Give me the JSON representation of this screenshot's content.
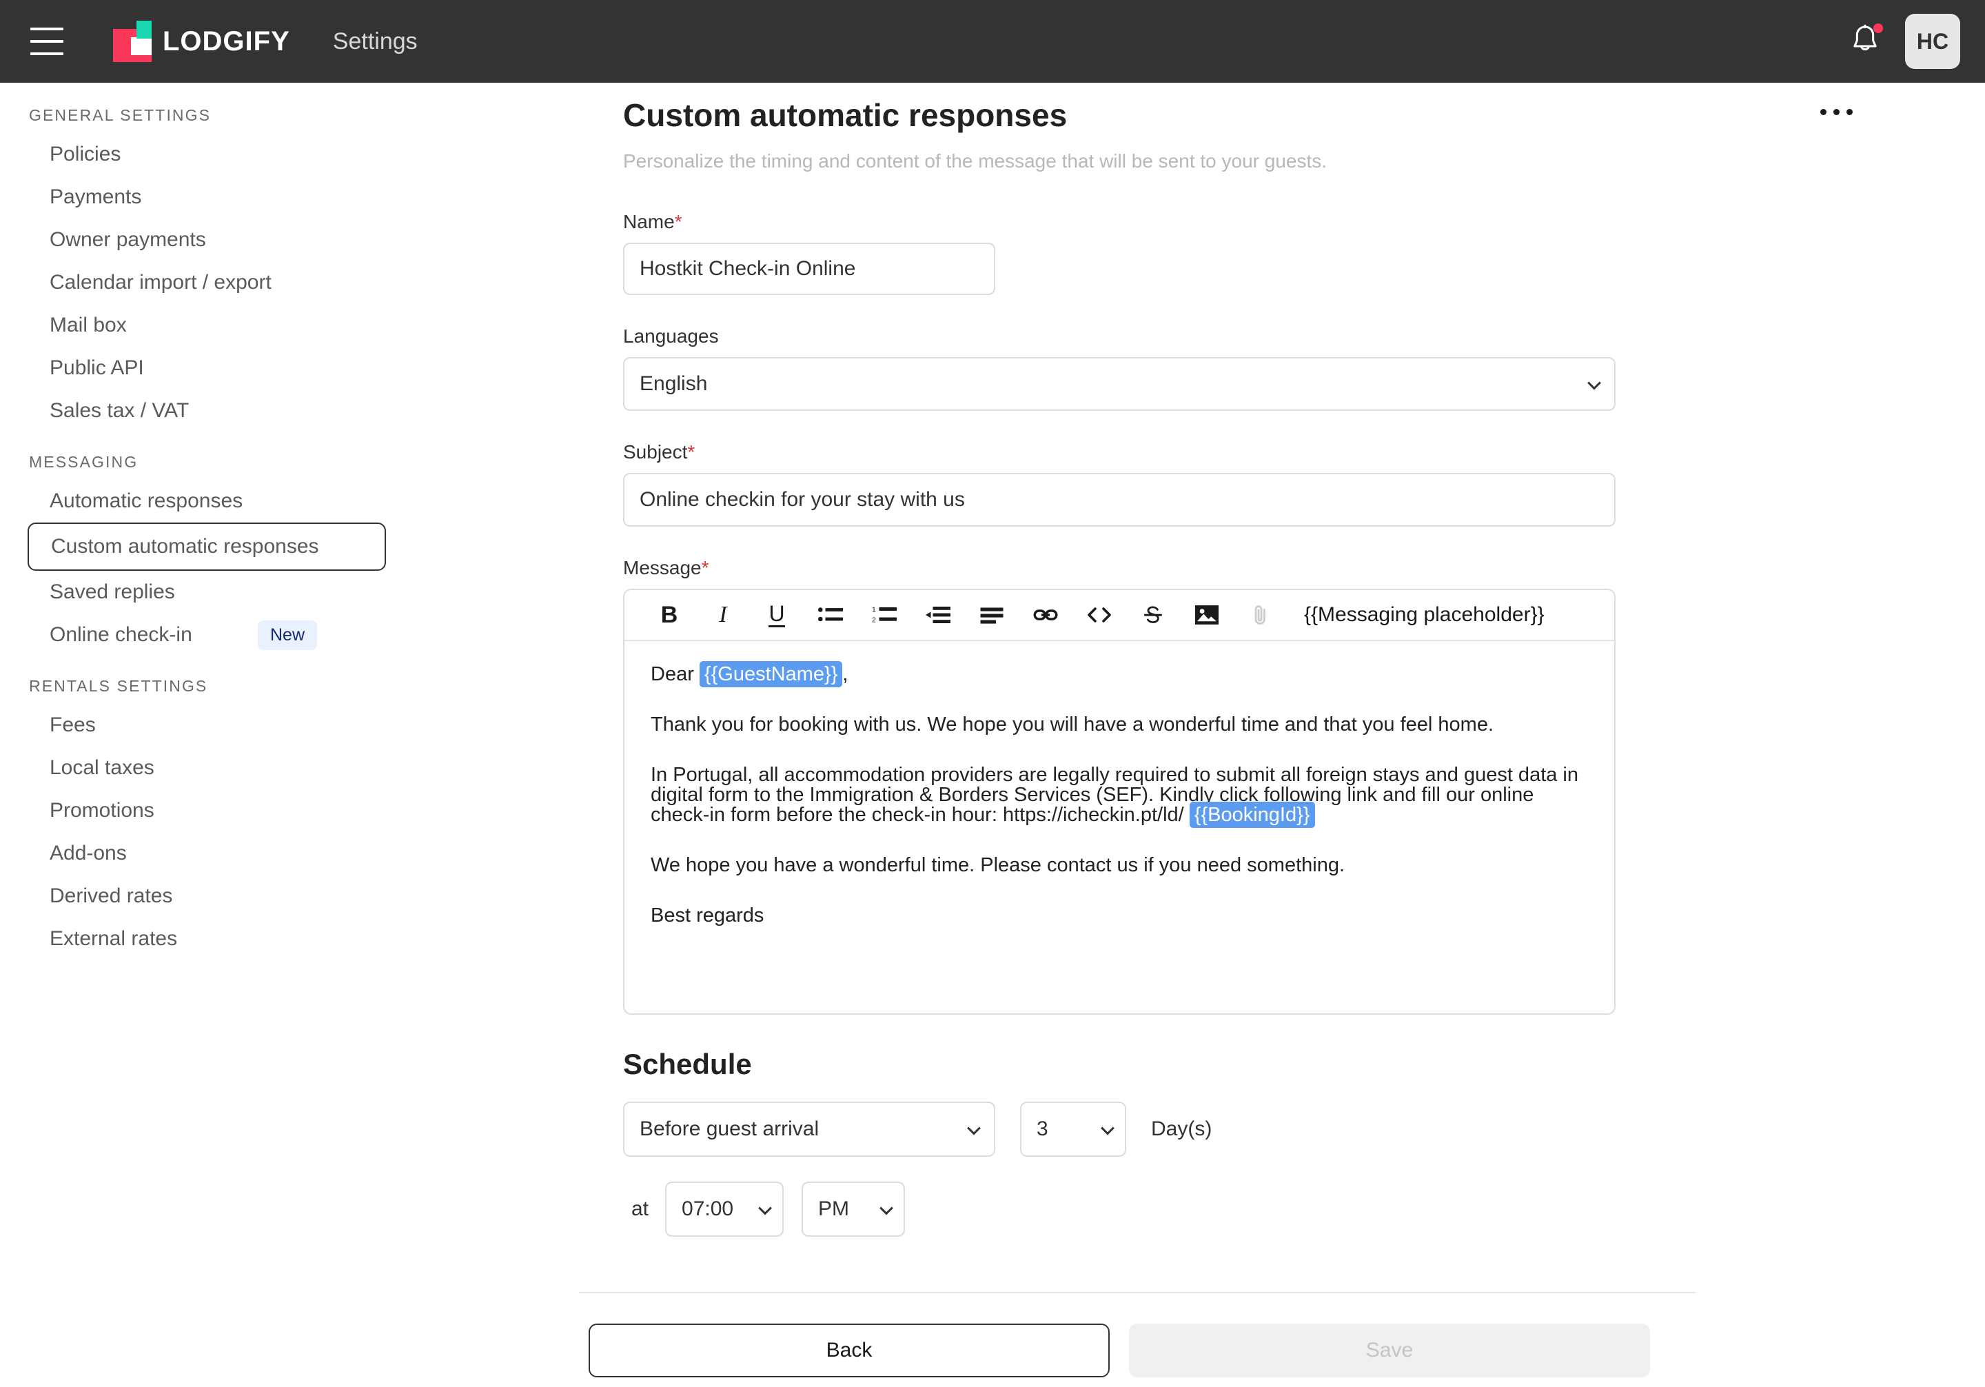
{
  "topbar": {
    "menu_icon": "hamburger-icon",
    "logo_text": "LODGIFY",
    "nav_label": "Settings",
    "bell_icon": "bell-icon",
    "avatar_initials": "HC",
    "brand_red": "#fa395a",
    "brand_teal": "#18d6b0",
    "bar_background": "#333333"
  },
  "sidebar": {
    "groups": [
      {
        "title": "GENERAL SETTINGS",
        "items": [
          {
            "label": "Policies",
            "selected": false,
            "badge": ""
          },
          {
            "label": "Payments",
            "selected": false,
            "badge": ""
          },
          {
            "label": "Owner payments",
            "selected": false,
            "badge": ""
          },
          {
            "label": "Calendar import / export",
            "selected": false,
            "badge": ""
          },
          {
            "label": "Mail box",
            "selected": false,
            "badge": ""
          },
          {
            "label": "Public API",
            "selected": false,
            "badge": ""
          },
          {
            "label": "Sales tax / VAT",
            "selected": false,
            "badge": ""
          }
        ]
      },
      {
        "title": "MESSAGING",
        "items": [
          {
            "label": "Automatic responses",
            "selected": false,
            "badge": ""
          },
          {
            "label": "Custom automatic responses",
            "selected": true,
            "badge": ""
          },
          {
            "label": "Saved replies",
            "selected": false,
            "badge": ""
          },
          {
            "label": "Online check-in",
            "selected": false,
            "badge": "New"
          }
        ]
      },
      {
        "title": "RENTALS SETTINGS",
        "items": [
          {
            "label": "Fees",
            "selected": false,
            "badge": ""
          },
          {
            "label": "Local taxes",
            "selected": false,
            "badge": ""
          },
          {
            "label": "Promotions",
            "selected": false,
            "badge": ""
          },
          {
            "label": "Add-ons",
            "selected": false,
            "badge": ""
          },
          {
            "label": "Derived rates",
            "selected": false,
            "badge": ""
          },
          {
            "label": "External rates",
            "selected": false,
            "badge": ""
          }
        ]
      }
    ],
    "badge_bg": "#e8f1fd",
    "badge_color": "#13296e"
  },
  "main": {
    "title": "Custom automatic responses",
    "subtitle": "Personalize the timing and content of the message that will be sent to your guests.",
    "overflow_icon": "kebab-menu-icon",
    "fields": {
      "name_label": "Name",
      "name_required": "*",
      "name_value": "Hostkit Check-in Online",
      "languages_label": "Languages",
      "languages_value": "English",
      "subject_label": "Subject",
      "subject_required": "*",
      "subject_value": "Online checkin for your stay with us",
      "message_label": "Message",
      "message_required": "*"
    },
    "editor": {
      "toolbar": [
        {
          "name": "bold-icon",
          "glyph": "B"
        },
        {
          "name": "italic-icon",
          "glyph": "I"
        },
        {
          "name": "underline-icon",
          "glyph": "U"
        },
        {
          "name": "bulleted-list-icon",
          "glyph": ""
        },
        {
          "name": "numbered-list-icon",
          "glyph": ""
        },
        {
          "name": "indent-icon",
          "glyph": ""
        },
        {
          "name": "align-icon",
          "glyph": ""
        },
        {
          "name": "link-icon",
          "glyph": ""
        },
        {
          "name": "code-icon",
          "glyph": ""
        },
        {
          "name": "strikethrough-icon",
          "glyph": ""
        },
        {
          "name": "image-icon",
          "glyph": ""
        },
        {
          "name": "attachment-icon",
          "glyph": ""
        }
      ],
      "placeholder_button": "{{Messaging placeholder}}",
      "highlight_color": "#5b9bf0",
      "body": {
        "greeting_prefix": "Dear ",
        "greeting_placeholder": "{{GuestName}}",
        "greeting_suffix": ",",
        "paragraph_2": "Thank you for booking with us. We hope you will have a wonderful time and that you feel home.",
        "paragraph_3_text": "In Portugal, all accommodation providers are legally required to submit all foreign stays and guest data in digital form to the Immigration & Borders Services (SEF). Kindly click following link and fill our online check-in form before the check-in hour: https://icheckin.pt/ld/ ",
        "paragraph_3_placeholder": "{{BookingId}}",
        "paragraph_4": "We hope you have a wonderful time. Please contact us if you need something.",
        "paragraph_5": "Best regards"
      }
    },
    "schedule": {
      "heading": "Schedule",
      "when_value": "Before guest arrival",
      "days_value": "3",
      "days_label": "Day(s)",
      "at_label": "at",
      "time_value": "07:00",
      "ampm_value": "PM"
    }
  },
  "footer": {
    "back_label": "Back",
    "save_label": "Save"
  }
}
